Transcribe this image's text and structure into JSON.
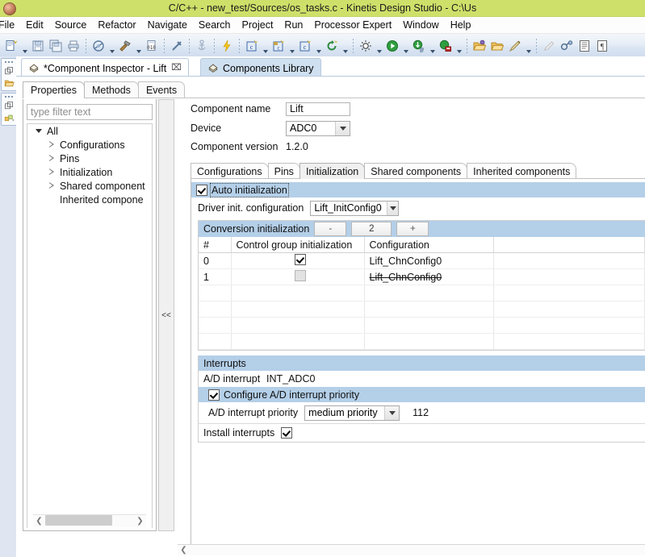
{
  "window": {
    "title": "C/C++ - new_test/Sources/os_tasks.c - Kinetis Design Studio - C:\\Us"
  },
  "menu": {
    "items": [
      "File",
      "Edit",
      "Source",
      "Refactor",
      "Navigate",
      "Search",
      "Project",
      "Run",
      "Processor Expert",
      "Window",
      "Help"
    ]
  },
  "toolbar": {
    "groups": [
      [
        "new-file-icon",
        "dropdown",
        "save-icon",
        "save-all-icon",
        "print-icon"
      ],
      [
        "build-icon",
        "dropdown",
        "hammer-build-icon",
        "dropdown",
        "binary-010-icon",
        "dropdown-dotted",
        "disconnect-icon"
      ],
      [
        "anchor-icon",
        "dropdown-dotted",
        "lightning-icon",
        "dropdown-dotted",
        "new-c-class-icon",
        "dropdown",
        "new-c-file-icon",
        "dropdown",
        "c-project-icon",
        "dropdown"
      ],
      [
        "refresh-icon",
        "dropdown",
        "sun-debug-icon",
        "dropdown",
        "run-icon",
        "dropdown",
        "debug-icon",
        "dropdown",
        "profile-icon",
        "dropdown"
      ],
      [
        "open-folder-icon",
        "open-folder2-icon",
        "pencil-icon",
        "dropdown"
      ],
      [
        "eraser-icon",
        "search-binoculars-icon",
        "outline-icon",
        "pilcrow-icon"
      ]
    ]
  },
  "rail": {
    "boxes": [
      {
        "icons": [
          "restore-view-icon",
          "folder-icon"
        ]
      },
      {
        "icons": [
          "restore-view-icon",
          "components-icon"
        ]
      }
    ]
  },
  "editor_tabs": [
    {
      "label": "*Component Inspector - Lift",
      "icon": "component-inspector-icon",
      "active": true,
      "closable": true,
      "close_glyph": "⌧"
    },
    {
      "label": "Components Library",
      "icon": "components-library-icon",
      "active": false,
      "closable": false
    }
  ],
  "inspector": {
    "view_tabs": [
      {
        "label": "Properties",
        "selected": true
      },
      {
        "label": "Methods",
        "selected": false
      },
      {
        "label": "Events",
        "selected": false
      }
    ],
    "filter_placeholder": "type filter text",
    "tree": [
      {
        "label": "All",
        "level": 0,
        "expander": "down"
      },
      {
        "label": "Configurations",
        "level": 1,
        "expander": "right"
      },
      {
        "label": "Pins",
        "level": 1,
        "expander": "right"
      },
      {
        "label": "Initialization",
        "level": 1,
        "expander": "right"
      },
      {
        "label": "Shared component",
        "level": 1,
        "expander": "right"
      },
      {
        "label": "Inherited compone",
        "level": 1,
        "expander": "none"
      }
    ],
    "collapse_handle": "<<",
    "header": {
      "component_name_label": "Component name",
      "component_name_value": "Lift",
      "device_label": "Device",
      "device_value": "ADC0",
      "component_version_label": "Component version",
      "component_version_value": "1.2.0"
    },
    "config_tabs": [
      {
        "label": "Configurations",
        "selected": false
      },
      {
        "label": "Pins",
        "selected": false
      },
      {
        "label": "Initialization",
        "selected": true
      },
      {
        "label": "Shared components",
        "selected": false
      },
      {
        "label": "Inherited components",
        "selected": false
      }
    ],
    "initialization": {
      "auto_init_label": "Auto initialization",
      "auto_init_checked": true,
      "driver_init_label": "Driver init. configuration",
      "driver_init_value": "Lift_InitConfig0",
      "conversion": {
        "title": "Conversion initialization",
        "minus_label": "-",
        "count_label": "2",
        "plus_label": "+",
        "columns": [
          "#",
          "Control group initialization",
          "Configuration",
          ""
        ],
        "rows": [
          {
            "index": "0",
            "control_group_checked": true,
            "control_group_disabled": false,
            "configuration": "Lift_ChnConfig0",
            "struck": false
          },
          {
            "index": "1",
            "control_group_checked": false,
            "control_group_disabled": true,
            "configuration": "Lift_ChnConfig0",
            "struck": true
          }
        ],
        "empty_rows": 4
      },
      "interrupts": {
        "title": "Interrupts",
        "ad_interrupt_label": "A/D interrupt",
        "ad_interrupt_value": "INT_ADC0",
        "configure_priority_label": "Configure A/D interrupt priority",
        "configure_priority_checked": true,
        "priority_label": "A/D interrupt priority",
        "priority_value": "medium priority",
        "priority_number": "112",
        "install_interrupts_label": "Install interrupts",
        "install_interrupts_checked": true
      }
    }
  },
  "colors": {
    "titlebar": "#cfe06a",
    "band": "#b4cfe8",
    "tab_inactive": "#cfe0f0",
    "index_cell": "#dce9f6"
  }
}
